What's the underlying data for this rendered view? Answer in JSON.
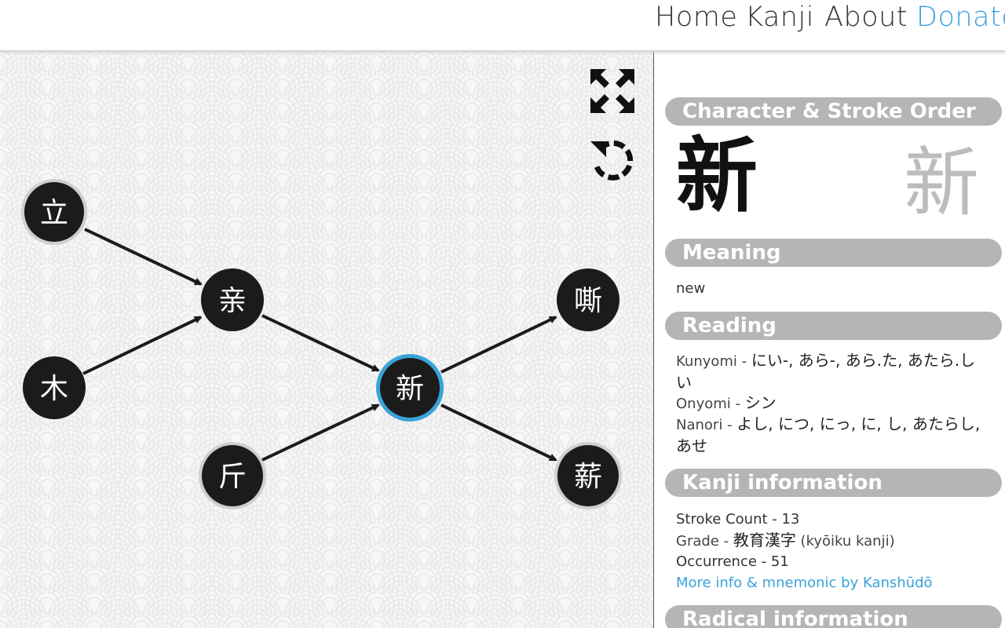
{
  "nav": {
    "home": "Home",
    "kanji": "Kanji",
    "about": "About",
    "donate": "Donate"
  },
  "graph": {
    "controls": {
      "fullscreen_icon": "expand-arrows-icon",
      "reset_icon": "rotate-left-icon"
    },
    "nodes": [
      {
        "id": "n-li",
        "char": "立",
        "ring": "gray"
      },
      {
        "id": "n-shin",
        "char": "亲",
        "ring": "none"
      },
      {
        "id": "n-ki",
        "char": "木",
        "ring": "none"
      },
      {
        "id": "n-kin",
        "char": "斤",
        "ring": "gray"
      },
      {
        "id": "n-new",
        "char": "新",
        "ring": "blue",
        "selected": true
      },
      {
        "id": "n-zan",
        "char": "嘶",
        "ring": "none"
      },
      {
        "id": "n-takigi",
        "char": "薪",
        "ring": "gray"
      }
    ],
    "edges": [
      [
        "立",
        "亲"
      ],
      [
        "木",
        "亲"
      ],
      [
        "亲",
        "新"
      ],
      [
        "斤",
        "新"
      ],
      [
        "新",
        "嘶"
      ],
      [
        "新",
        "薪"
      ]
    ]
  },
  "panel": {
    "character_header": "Character & Stroke Order",
    "kanji": "新",
    "stroke_kanji": "新",
    "meaning_header": "Meaning",
    "meaning": "new",
    "reading_header": "Reading",
    "kunyomi_label": "Kunyomi - ",
    "kunyomi": "にい-, あら-, あら.た, あたら.しい",
    "onyomi_label": "Onyomi - ",
    "onyomi": "シン",
    "nanori_label": "Nanori - ",
    "nanori": "よし, につ, にっ, に, し, あたらし, あせ",
    "kanji_info_header": "Kanji information",
    "stroke_count": "Stroke Count - 13",
    "grade_label": "Grade - ",
    "grade_value": "教育漢字",
    "grade_note": " (kyōiku kanji)",
    "occurrence": "Occurrence - 51",
    "more_info_link": "More info & mnemonic by Kanshūdō",
    "radical_header": "Radical information"
  },
  "colors": {
    "accent": "#3aa3d9",
    "header_bg": "#b5b5b5",
    "node_bg": "#1b1b1b"
  }
}
